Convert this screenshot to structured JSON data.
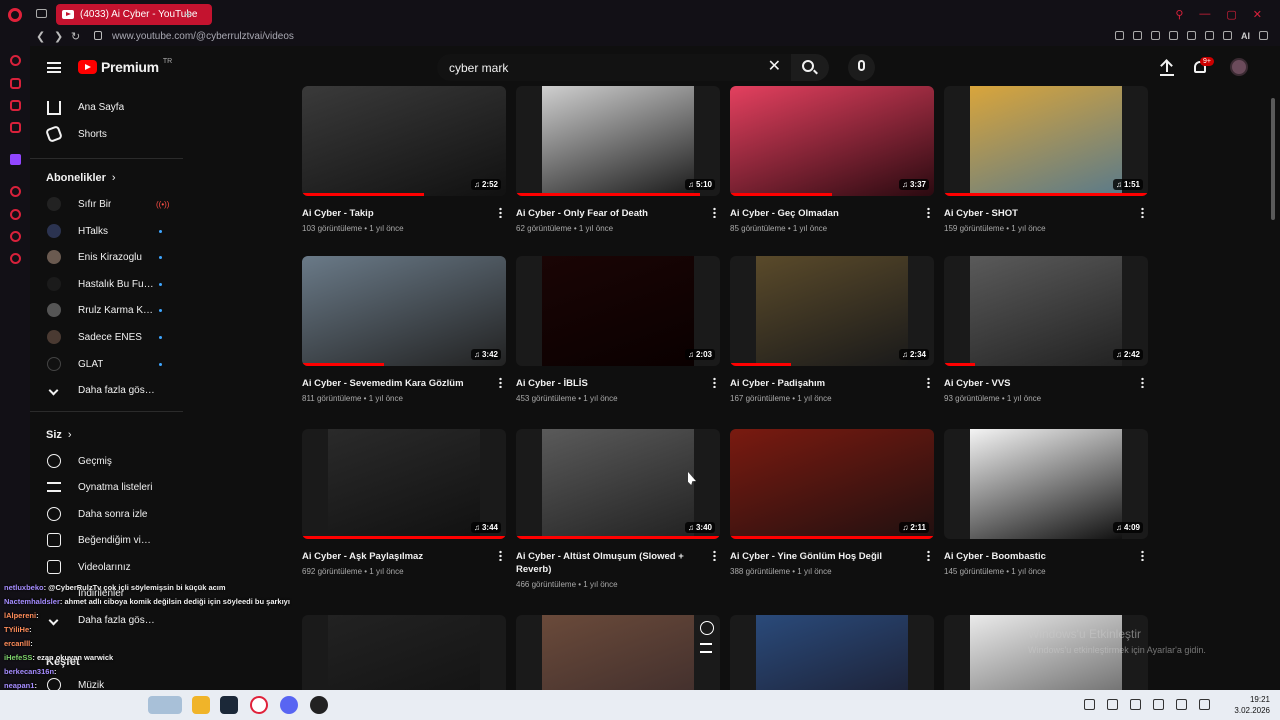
{
  "browser": {
    "tab_title": "(4033) Ai Cyber - YouTube",
    "url": "www.youtube.com/@cyberrulztvai/videos",
    "ai_label": "AI"
  },
  "masthead": {
    "logo_text": "Premium",
    "country_code": "TR",
    "search_value": "cyber mark",
    "notification_count": "9+"
  },
  "guide": {
    "home": "Ana Sayfa",
    "shorts": "Shorts",
    "subscriptions_header": "Abonelikler",
    "channels": [
      {
        "name": "Sıfır Bir",
        "status": "live"
      },
      {
        "name": "HTalks",
        "status": "new"
      },
      {
        "name": "Enis Kirazoglu",
        "status": "new"
      },
      {
        "name": "Hastalık Bu Futbol",
        "status": "new"
      },
      {
        "name": "Rrulz Karma Kan...",
        "status": "new"
      },
      {
        "name": "Sadece ENES",
        "status": "new"
      },
      {
        "name": "GLAT",
        "status": "new"
      }
    ],
    "show_more": "Daha fazla göster",
    "you_header": "Siz",
    "you_items": [
      "Geçmiş",
      "Oynatma listeleri",
      "Daha sonra izle",
      "Beğendiğim videolar",
      "Videolarınız",
      "İndirilenler"
    ],
    "show_more_2": "Daha fazla göster",
    "explore": "Keşfet",
    "music": "Müzik"
  },
  "videos": [
    {
      "title": "Ai Cyber - Takip",
      "views": "103 görüntüleme",
      "age": "1 yıl önce",
      "duration": "2:52",
      "watched": 0.6
    },
    {
      "title": "Ai Cyber - Only Fear of Death",
      "views": "62 görüntüleme",
      "age": "1 yıl önce",
      "duration": "5:10",
      "watched": 0.9
    },
    {
      "title": "Ai Cyber - Geç Olmadan",
      "views": "85 görüntüleme",
      "age": "1 yıl önce",
      "duration": "3:37",
      "watched": 0.5
    },
    {
      "title": "Ai Cyber - SHOT",
      "views": "159 görüntüleme",
      "age": "1 yıl önce",
      "duration": "1:51",
      "watched": 1.0
    },
    {
      "title": "Ai Cyber - Sevemedim Kara Gözlüm",
      "views": "811 görüntüleme",
      "age": "1 yıl önce",
      "duration": "3:42",
      "watched": 0.4
    },
    {
      "title": "Ai Cyber - İBLİS",
      "views": "453 görüntüleme",
      "age": "1 yıl önce",
      "duration": "2:03",
      "watched": 0
    },
    {
      "title": "Ai Cyber - Padişahım",
      "views": "167 görüntüleme",
      "age": "1 yıl önce",
      "duration": "2:34",
      "watched": 0.3
    },
    {
      "title": "Ai Cyber - VVS",
      "views": "93 görüntüleme",
      "age": "1 yıl önce",
      "duration": "2:42",
      "watched": 0.15
    },
    {
      "title": "Ai Cyber - Aşk Paylaşılmaz",
      "views": "692 görüntüleme",
      "age": "1 yıl önce",
      "duration": "3:44",
      "watched": 1.0
    },
    {
      "title": "Ai Cyber - Altüst Olmuşum (Slowed + Reverb)",
      "views": "466 görüntüleme",
      "age": "1 yıl önce",
      "duration": "3:40",
      "watched": 1.0
    },
    {
      "title": "Ai Cyber - Yine Gönlüm Hoş Değil",
      "views": "388 görüntüleme",
      "age": "1 yıl önce",
      "duration": "2:11",
      "watched": 1.0
    },
    {
      "title": "Ai Cyber - Boombastic",
      "views": "145 görüntüleme",
      "age": "1 yıl önce",
      "duration": "4:09",
      "watched": 0
    }
  ],
  "colors": {
    "yt_red": "#ff0000",
    "opera_red": "#c4132f",
    "background": "#0f0f0f"
  },
  "watermark": {
    "title": "Windows'u Etkinleştir",
    "subtitle": "Windows'u etkinleştirmek için Ayarlar'a gidin."
  },
  "chat": [
    {
      "user": "netluxbeko",
      "text": ": @CyberRulzTv çok içli söylemişsin bi küçük acım"
    },
    {
      "user": "Nactemhaldsler",
      "text": ": ahmet adlı ciboya komik değilsin dediği için söyleedi bu şarkıyı"
    },
    {
      "user": "lAlpereni",
      "text": ":"
    },
    {
      "user": "TYiliHe",
      "text": ":"
    },
    {
      "user": "ercanlll",
      "text": ":"
    },
    {
      "user": "iHefeSS",
      "text": ": ezan okuyan warwick"
    },
    {
      "user": "berkecan316n",
      "text": ":"
    },
    {
      "user": "neapan1",
      "text": ":"
    }
  ],
  "taskbar": {
    "time": "19:21",
    "date": "3.02.2026"
  }
}
